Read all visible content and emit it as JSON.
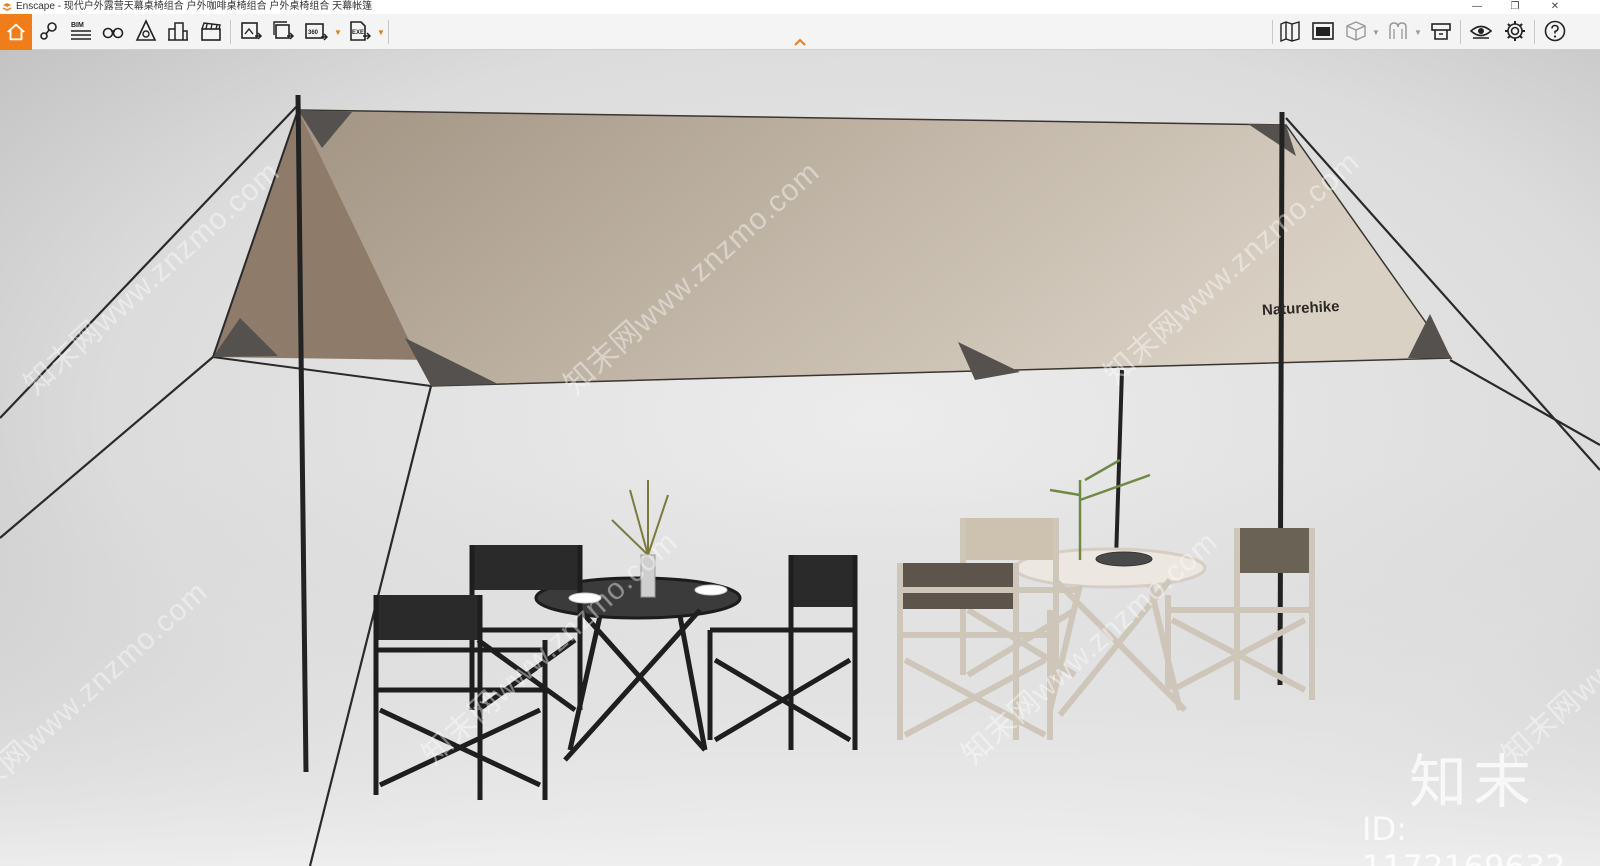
{
  "window": {
    "title": "Enscape - 现代户外露营天幕桌椅组合 户外咖啡桌椅组合 户外桌椅组合 天幕帐篷",
    "minimize": "—",
    "restore": "❐",
    "close": "✕"
  },
  "toolbar": {
    "left": [
      {
        "name": "home-icon",
        "active": true
      },
      {
        "name": "location-pin-icon"
      },
      {
        "name": "bim-icon",
        "label": "BIM"
      },
      {
        "name": "binoculars-icon"
      },
      {
        "name": "compass-icon"
      },
      {
        "name": "buildings-icon"
      },
      {
        "name": "clapperboard-icon"
      },
      {
        "name": "render-image-icon"
      },
      {
        "name": "batch-render-icon"
      },
      {
        "name": "panorama-360-icon",
        "label": "360°",
        "dropdown": true
      },
      {
        "name": "export-exe-icon",
        "label": "EXE",
        "dropdown": true
      }
    ],
    "right": [
      {
        "name": "map-icon"
      },
      {
        "name": "minimap-icon"
      },
      {
        "name": "cube-view-icon",
        "dropdown": true
      },
      {
        "name": "vr-headset-icon",
        "dropdown": true
      },
      {
        "name": "asset-library-icon"
      },
      {
        "name": "visual-settings-eye-icon"
      },
      {
        "name": "settings-gear-icon"
      },
      {
        "name": "help-icon"
      }
    ],
    "accent_color": "#f07d1a"
  },
  "scene": {
    "tarp_logo": "Naturehike",
    "watermark_text": "知末网www.znzmo.com",
    "brand_mark": "知末",
    "id_text": "ID: 1172169632"
  }
}
